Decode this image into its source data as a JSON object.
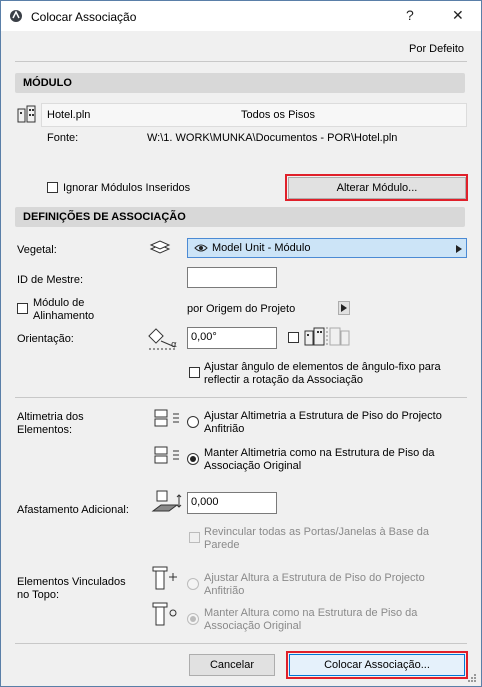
{
  "window": {
    "title": "Colocar Associação",
    "help": "?",
    "close": "✕"
  },
  "top": {
    "default_link": "Por Defeito"
  },
  "module": {
    "header": "MÓDULO",
    "file_name": "Hotel.pln",
    "floors": "Todos os Pisos",
    "source_label": "Fonte:",
    "source_path": "W:\\1. WORK\\MUNKA\\Documentos - POR\\Hotel.pln",
    "ignore_label": "Ignorar Módulos Inseridos",
    "change_button": "Alterar Módulo..."
  },
  "settings": {
    "header": "DEFINIÇÕES DE ASSOCIAÇÃO",
    "vegetal_label": "Vegetal:",
    "vegetal_value": "Model Unit - Módulo",
    "master_id_label": "ID de Mestre:",
    "master_id_value": "",
    "alignment_label": "Módulo de Alinhamento",
    "alignment_value": "por Origem do Projeto",
    "orientation_label": "Orientação:",
    "orientation_value": "0,00°",
    "adjust_angle_label": "Ajustar ângulo de elementos de ângulo-fixo para reflectir a rotação da Associação"
  },
  "elevation": {
    "label": "Altimetria dos Elementos:",
    "option_adjust": "Ajustar Altimetria a Estrutura de Piso do Projecto Anfitrião",
    "option_keep": "Manter Altimetria como na Estrutura de Piso da Associação Original",
    "selected": "keep"
  },
  "offset": {
    "label": "Afastamento Adicional:",
    "value": "0,000",
    "relink_label": "Revincular todas as Portas/Janelas à Base da Parede"
  },
  "top_linked": {
    "label": "Elementos Vinculados no Topo:",
    "option_adjust": "Ajustar Altura a Estrutura de Piso do Projecto Anfitrião",
    "option_keep": "Manter Altura como na Estrutura de Piso da Associação Original"
  },
  "footer": {
    "cancel": "Cancelar",
    "place": "Colocar Associação..."
  },
  "colors": {
    "highlight": "#e0202a",
    "accent": "#0078d7"
  }
}
